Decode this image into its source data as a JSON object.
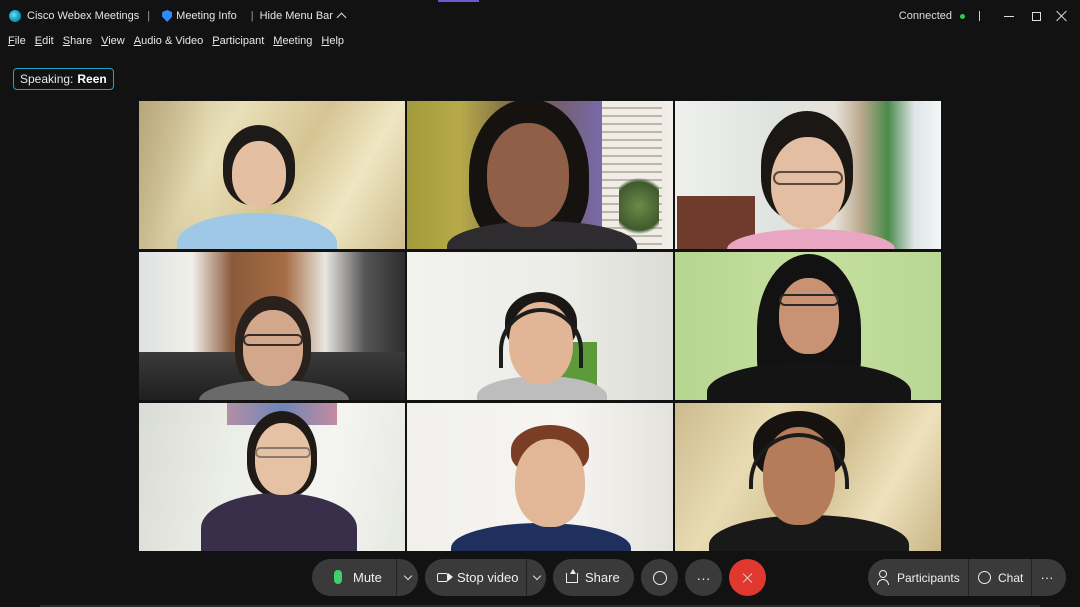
{
  "titlebar": {
    "app_name": "Cisco Webex Meetings",
    "meeting_info": "Meeting Info",
    "hide_menu_bar": "Hide Menu Bar",
    "status": "Connected"
  },
  "menu": [
    "File",
    "Edit",
    "Share",
    "View",
    "Audio & Video",
    "Participant",
    "Meeting",
    "Help"
  ],
  "speaking": {
    "label": "Speaking:",
    "name": "Reen"
  },
  "participants_grid": {
    "rows": 3,
    "columns": 3,
    "active_speaker_tile_index": 1
  },
  "toolbar": {
    "mute": "Mute",
    "stop_video": "Stop video",
    "share": "Share",
    "more": "···",
    "participants": "Participants",
    "chat": "Chat",
    "panel_more": "···"
  },
  "colors": {
    "accent": "#14a3c7",
    "end_call": "#e0382f",
    "connected": "#2ecc52",
    "mic_active": "#3fd16b"
  }
}
